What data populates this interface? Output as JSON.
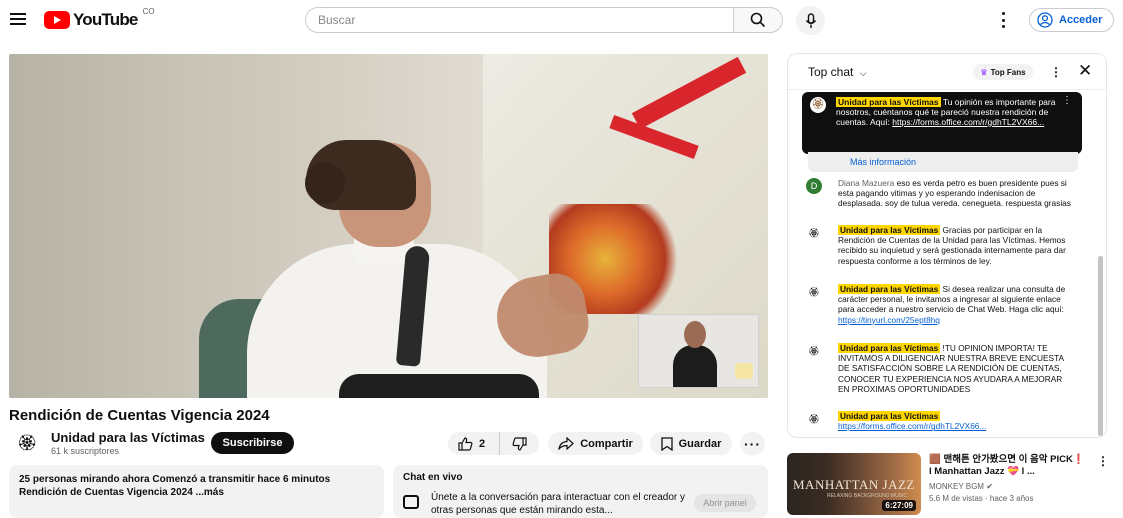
{
  "header": {
    "logo_text": "YouTube",
    "logo_country": "CO",
    "search_placeholder": "Buscar",
    "signin_label": "Acceder"
  },
  "video": {
    "title": "Rendición de Cuentas Vigencia 2024",
    "channel_name": "Unidad para las Víctimas",
    "subscribers": "61 k suscriptores",
    "subscribe_label": "Suscribirse",
    "likes": "2",
    "share_label": "Compartir",
    "save_label": "Guardar",
    "more_label": "···"
  },
  "description": {
    "line1": "25 personas mirando ahora  Comenzó a transmitir hace 6 minutos",
    "line2": "Rendición de Cuentas Vigencia 2024 ...más"
  },
  "live_chat_box": {
    "title": "Chat en vivo",
    "text": "Únete a la conversación para interactuar con el creador y otras personas que están mirando esta...",
    "open_label": "Abrir panel"
  },
  "chat": {
    "title": "Top chat",
    "top_fans_label": "Top Fans",
    "pinned": {
      "author": "Unidad para las Víctimas",
      "text": "Tu opinión es importante para nosotros, cuéntanos qué te pareció nuestra rendición de cuentas. Aquí: ",
      "link": "https://forms.office.com/r/gdhTL2VX66..."
    },
    "more_info_label": "Más información",
    "messages": [
      {
        "author": "Diana Mazuera",
        "text": "eso es verda petro es buen presidente pues si esta pagando vitimas y yo esperando indenisacion de desplasada. soy de tulua vereda. cenegueta. respuesta grasias",
        "link": "",
        "highlight": false,
        "avatar": "D"
      },
      {
        "author": "Unidad para las Víctimas",
        "text": "Gracias por participar en la Rendición de Cuentas de la Unidad para las Víctimas. Hemos recibido su inquietud y será gestionada internamente para dar respuesta conforme a los términos de ley.",
        "link": "",
        "highlight": true,
        "avatar": "🏵"
      },
      {
        "author": "Unidad para las Víctimas",
        "text": "Si desea realizar una consulta de carácter personal, le invitamos a ingresar al siguiente enlace para acceder a nuestro servicio de Chat Web. Haga clic aquí: ",
        "link": "https://tinyurl.com/25ept8hq",
        "highlight": true,
        "avatar": "🏵"
      },
      {
        "author": "Unidad para las Víctimas",
        "text": "!TU OPINION IMPORTA! TE INVITAMOS A DILIGENCIAR NUESTRA BREVE ENCUESTA DE SATISFACCIÓN SOBRE LA RENDICIÓN DE CUENTAS, CONOCER TU EXPERIENCIA NOS AYUDARA A MEJORAR EN PROXIMAS OPORTUNIDADES",
        "link": "",
        "highlight": true,
        "avatar": "🏵"
      },
      {
        "author": "Unidad para las Víctimas",
        "text": "",
        "link": "https://forms.office.com/r/gdhTL2VX66...",
        "highlight": true,
        "avatar": "🏵"
      }
    ]
  },
  "recommendation": {
    "thumb_title": "MANHATTAN JAZZ",
    "thumb_subtitle": "RELAXING BACKGROUND MUSIC",
    "duration": "6:27:09",
    "title": "🟫 맨해튼 안가봤으면 이 음악 PICK❗ l Manhattan Jazz 💝 l ...",
    "channel": "MONKEY BGM ✔",
    "meta": "5.6 M de vistas · hace 3 años"
  }
}
